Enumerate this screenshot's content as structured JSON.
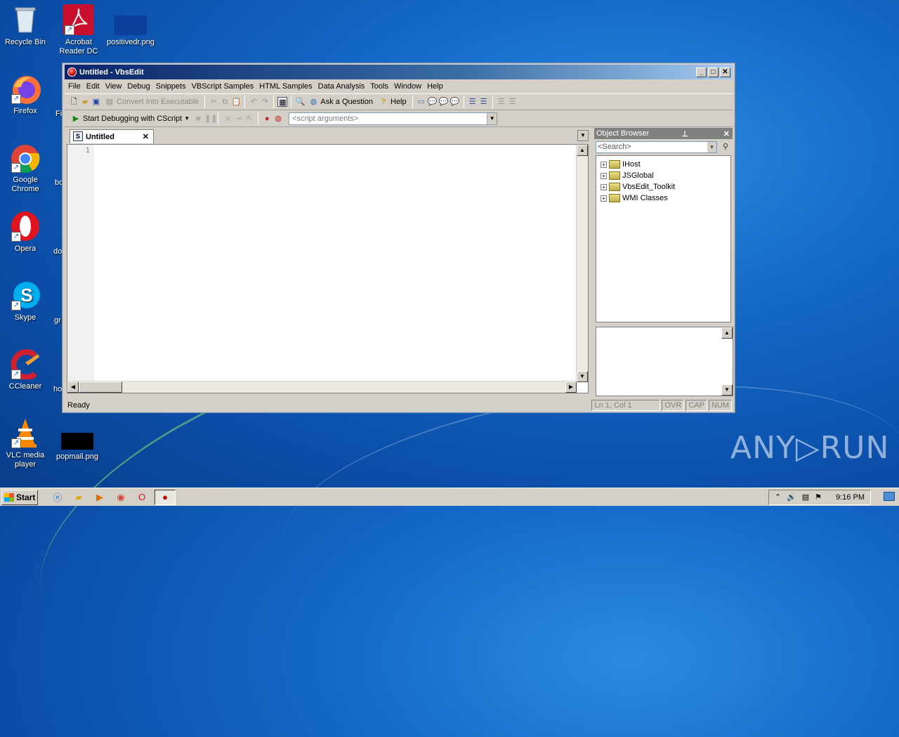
{
  "desktop": {
    "icons": [
      {
        "label": "Recycle Bin"
      },
      {
        "label": "Acrobat Reader DC"
      },
      {
        "label": "positivedr.png"
      },
      {
        "label": "Firefox"
      },
      {
        "label": "Google Chrome"
      },
      {
        "label": "Opera"
      },
      {
        "label": "Skype"
      },
      {
        "label": "CCleaner"
      },
      {
        "label": "VLC media player"
      },
      {
        "label": "popmail.png"
      }
    ],
    "cut_labels": [
      "Fi",
      "bo",
      "do",
      "gr",
      "ho"
    ],
    "watermark": "ANY▷RUN"
  },
  "window": {
    "title": "Untitled - VbsEdit",
    "buttons": {
      "minimize": "_",
      "maximize": "□",
      "close": "✕"
    },
    "menu": [
      "File",
      "Edit",
      "View",
      "Debug",
      "Snippets",
      "VBScript Samples",
      "HTML Samples",
      "Data Analysis",
      "Tools",
      "Window",
      "Help"
    ],
    "toolbar1": {
      "convert": "Convert Into Executable",
      "ask": "Ask a Question",
      "help": "Help"
    },
    "toolbar2": {
      "start_debug": "Start Debugging with CScript",
      "script_args_placeholder": "<script arguments>"
    },
    "editor": {
      "tab_label": "Untitled",
      "tab_close": "✕",
      "line_number": "1"
    },
    "object_browser": {
      "title": "Object Browser",
      "search_placeholder": "<Search>",
      "items": [
        "IHost",
        "JSGlobal",
        "VbsEdit_Toolkit",
        "WMI Classes"
      ]
    },
    "status": {
      "ready": "Ready",
      "position": "Ln 1, Col 1",
      "ovr": "OVR",
      "cap": "CAP",
      "num": "NUM"
    }
  },
  "taskbar": {
    "start_label": "Start",
    "time": "9:16 PM"
  }
}
